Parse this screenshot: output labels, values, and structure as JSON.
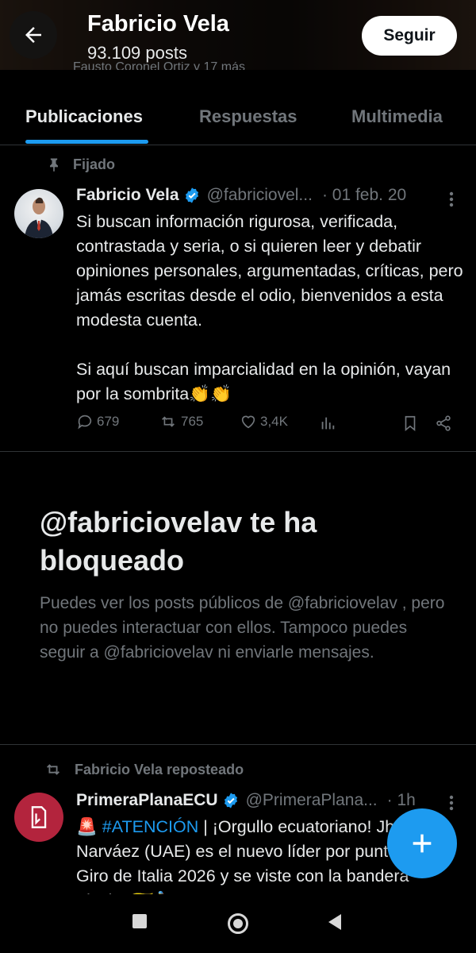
{
  "header": {
    "name": "Fabricio Vela",
    "posts": "93.109 posts",
    "sub_text": "Fausto Coronel Ortiz y 17 más",
    "follow_label": "Seguir"
  },
  "tabs": [
    {
      "label": "Publicaciones",
      "active": true
    },
    {
      "label": "Respuestas",
      "active": false
    },
    {
      "label": "Multimedia",
      "active": false
    }
  ],
  "pinned_tweet": {
    "pinned_label": "Fijado",
    "author": "Fabricio Vela",
    "handle": "@fabriciovel...",
    "date": "· 01 feb. 20",
    "text_p1": "Si buscan información rigurosa, verificada, contrastada y seria, o si quieren leer y debatir opiniones personales, argumentadas, críticas, pero jamás escritas desde el odio, bienvenidos a esta modesta cuenta.",
    "text_p2": "Si aquí buscan imparcialidad en la opinión, vayan por la sombrita👏👏",
    "replies": "679",
    "reposts": "765",
    "likes": "3,4K"
  },
  "blocked": {
    "title": "@fabriciovelav te ha bloqueado",
    "description": "Puedes ver los posts públicos de @fabriciovelav , pero no puedes interactuar con ellos. Tampoco puedes seguir a @fabriciovelav ni enviarle mensajes."
  },
  "repost": {
    "label": "Fabricio Vela reposteado",
    "author": "PrimeraPlanaECU",
    "handle": "@PrimeraPlana...",
    "time": "· 1h",
    "alert_emoji": "🚨",
    "hashtag": "#ATENCIÓN",
    "text": " | ¡Orgullo ecuatoriano! Jhonatan Narváez (UAE) es el nuevo líder por puntos del Giro de Italia 2026 y se viste con la bandera tricolor 🇪🇨🚴"
  },
  "colors": {
    "accent": "#1d9bf0",
    "verified": "#1d9bf0",
    "repost_avatar": "#b3243d"
  }
}
